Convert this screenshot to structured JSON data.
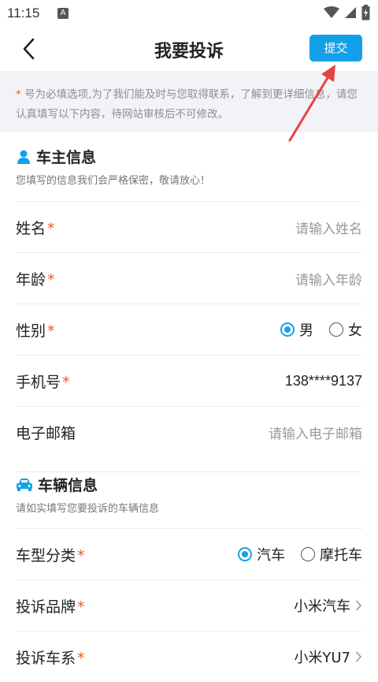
{
  "status": {
    "time": "11:15",
    "notif_letter": "A"
  },
  "nav": {
    "title": "我要投诉",
    "submit_label": "提交"
  },
  "notice": {
    "star": "*",
    "text": " 号为必填选项,为了我们能及时与您取得联系，了解到更详细信息，请您认真填写以下内容，待网站审核后不可修改。"
  },
  "owner_section": {
    "title": "车主信息",
    "subtitle": "您填写的信息我们会严格保密，敬请放心！",
    "name": {
      "label": "姓名",
      "required": "*",
      "placeholder": "请输入姓名"
    },
    "age": {
      "label": "年龄",
      "required": "*",
      "placeholder": "请输入年龄"
    },
    "gender": {
      "label": "性别",
      "required": "*",
      "options": [
        "男",
        "女"
      ],
      "selected": "男"
    },
    "phone": {
      "label": "手机号",
      "required": "*",
      "value": "138****9137"
    },
    "email": {
      "label": "电子邮箱",
      "placeholder": "请输入电子邮箱"
    }
  },
  "vehicle_section": {
    "title": "车辆信息",
    "subtitle": "请如实填写您要投诉的车辆信息",
    "type": {
      "label": "车型分类",
      "required": "*",
      "options": [
        "汽车",
        "摩托车"
      ],
      "selected": "汽车"
    },
    "brand": {
      "label": "投诉品牌",
      "required": "*",
      "value": "小米汽车"
    },
    "series": {
      "label": "投诉车系",
      "required": "*",
      "value": "小米YU7"
    }
  },
  "colors": {
    "accent": "#14a0e8",
    "required": "#f05a24",
    "annotation": "#e8423f"
  },
  "icons": {
    "back": "chevron-left-icon",
    "owner": "person-icon",
    "vehicle": "car-icon",
    "chevron": "chevron-right-icon"
  }
}
